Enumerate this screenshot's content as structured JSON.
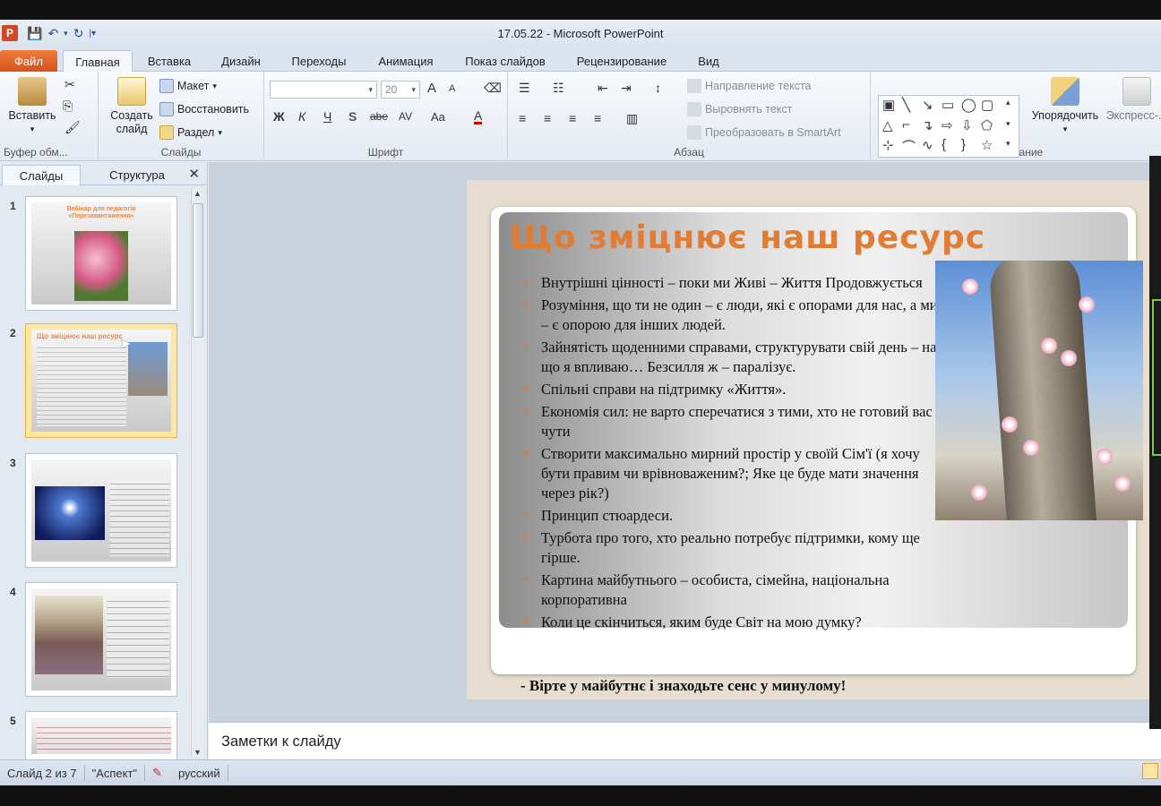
{
  "window": {
    "title": "17.05.22  -  Microsoft PowerPoint",
    "app_icon_letter": "P"
  },
  "tabs": {
    "file": "Файл",
    "home": "Главная",
    "insert": "Вставка",
    "design": "Дизайн",
    "transitions": "Переходы",
    "animation": "Анимация",
    "slideshow": "Показ слайдов",
    "review": "Рецензирование",
    "view": "Вид"
  },
  "ribbon": {
    "clipboard": {
      "label": "Буфер обм...",
      "paste": "Вставить"
    },
    "slides": {
      "label": "Слайды",
      "new_slide_line1": "Создать",
      "new_slide_line2": "слайд",
      "layout": "Макет",
      "reset": "Восстановить",
      "section": "Раздел"
    },
    "font": {
      "label": "Шрифт",
      "font_name": "",
      "font_size": "20",
      "bold": "Ж",
      "italic": "К",
      "underline": "Ч",
      "shadow": "S",
      "strike": "abe",
      "spacing": "AV",
      "case": "Aa",
      "color": "A",
      "grow": "A",
      "shrink": "A"
    },
    "paragraph": {
      "label": "Абзац",
      "text_direction": "Направление текста",
      "align_text": "Выровнять текст",
      "smartart": "Преобразовать в SmartArt"
    },
    "drawing": {
      "label": "Рисование",
      "arrange": "Упорядочить",
      "quick_styles": "Экспресс-..."
    }
  },
  "left_pane": {
    "tab_slides": "Слайды",
    "tab_outline": "Структура",
    "close": "✕",
    "thumbnails": [
      {
        "number": "1",
        "title": "Вебінар для педагогів «Перезавантаження»"
      },
      {
        "number": "2",
        "title": "Що зміцнює наш ресурс"
      },
      {
        "number": "3",
        "title": ""
      },
      {
        "number": "4",
        "title": ""
      },
      {
        "number": "5",
        "title": ""
      }
    ]
  },
  "slide": {
    "title": "Що зміцнює наш ресурс",
    "bullets": [
      "Внутрішні цінності – поки ми Живі – Життя Продовжується",
      "Розуміння, що ти не один – є люди, які є опорами для нас, а ми – є опорою для інших людей.",
      "Зайнятість щоденними справами, структурувати свій день – на що я впливаю… Безсилля ж – паралізує.",
      "Спільні справи на підтримку «Життя».",
      "Економія сил: не варто сперечатися з тими, хто не готовий вас чути",
      "Створити максимально мирний  простір у своїй Сім'ї (я хочу бути правим  чи врівноваженим?; Яке це буде мати значення через рік?)",
      "Принцип  стюардеси.",
      "Турбота про того, хто реально потребує підтримки, кому ще гірше.",
      "Картина  майбутнього – особиста, сімейна, національна  корпоративна",
      "Коли це скінчиться, яким буде Світ на мою думку?"
    ],
    "footer": "- Вірте у майбутнє і знаходьте сенс у минулому!"
  },
  "notes": {
    "placeholder": "Заметки к слайду"
  },
  "status": {
    "slide_counter": "Слайд 2 из 7",
    "theme": "\"Аспект\"",
    "language": "русский"
  },
  "colors": {
    "accent_orange": "#e07c33",
    "file_tab": "#d4541c",
    "selected_thumb": "#fde6a3"
  }
}
